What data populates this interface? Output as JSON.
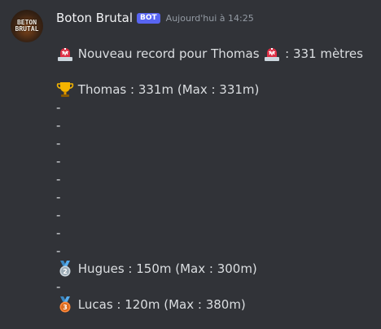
{
  "message": {
    "author": "Boton Brutal",
    "bot_tag": "BOT",
    "timestamp": "Aujourd'hui à 14:25",
    "avatar_text": [
      "BETON",
      "BRUTAL"
    ],
    "headline": "Nouveau record pour Thomas",
    "headline_suffix": ": 331 mètres",
    "first_place": "Thomas : 331m (Max : 331m)",
    "separator": "-",
    "second_place": "Hugues : 150m (Max : 300m)",
    "third_place": "Lucas : 120m (Max : 380m)"
  },
  "icons": {
    "headline_left": "rotating-light-icon",
    "headline_right": "rotating-light-icon",
    "first": "trophy-icon",
    "second": "second-place-medal-icon",
    "third": "third-place-medal-icon"
  },
  "colors": {
    "background": "#313338",
    "text": "#dbdee1",
    "bot_tag": "#5865f2",
    "timestamp": "#949ba4"
  }
}
